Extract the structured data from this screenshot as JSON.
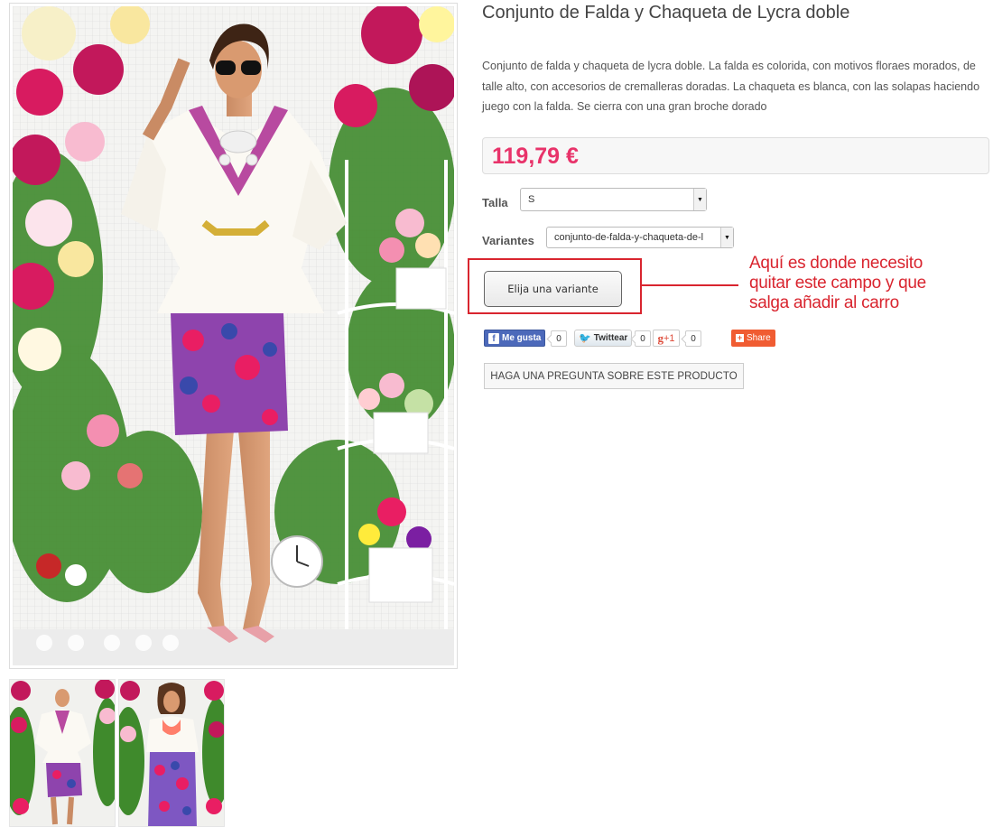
{
  "product": {
    "title": "Conjunto de Falda y Chaqueta de Lycra doble",
    "description": "Conjunto de falda y chaqueta de lycra doble. La falda es colorida, con motivos floraes morados, de talle alto, con accesorios de cremalleras doradas. La chaqueta es blanca, con las solapas haciendo juego con la falda. Se cierra con una gran broche dorado",
    "price": "119,79 €",
    "price_color": "#e8336a"
  },
  "options": {
    "size_label": "Talla",
    "size_value": "S",
    "variants_label": "Variantes",
    "variants_value": "conjunto-de-falda-y-chaqueta-de-l"
  },
  "actions": {
    "choose_variant_label": "Elija una variante",
    "ask_question_label": "HAGA UNA PREGUNTA SOBRE ESTE PRODUCTO"
  },
  "annotation": {
    "text_lines": [
      "Aquí es donde necesito",
      "quitar este campo y que",
      "salga añadir al carro"
    ],
    "color": "#d9252f"
  },
  "social": {
    "facebook": {
      "label": "Me gusta",
      "count": "0",
      "icon": "facebook-icon"
    },
    "twitter": {
      "label": "Twittear",
      "count": "0",
      "icon": "twitter-bird-icon"
    },
    "google_plus": {
      "label": "+1",
      "count": "0",
      "icon": "google-plus-icon"
    },
    "share": {
      "label": "Share",
      "icon": "share-plus-icon"
    }
  },
  "gallery": {
    "thumbnails": [
      "thumbnail-white-jacket",
      "thumbnail-coral-top"
    ]
  },
  "colors": {
    "accent": "#e8336a",
    "annotation": "#d9252f",
    "facebook": "#4c69ba",
    "share": "#f05c32"
  }
}
